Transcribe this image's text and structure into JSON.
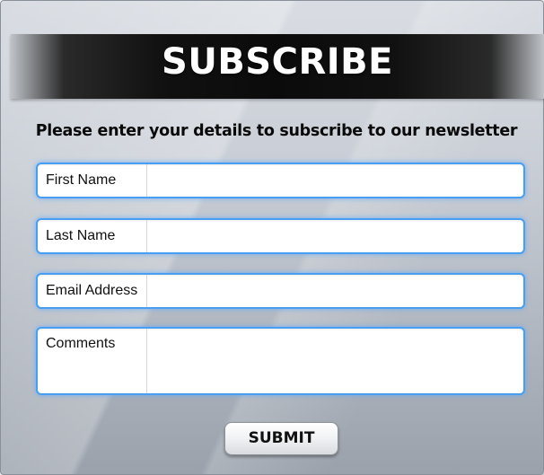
{
  "header": {
    "title": "SUBSCRIBE"
  },
  "intro": {
    "text": "Please enter your details to subscribe to our newsletter"
  },
  "form": {
    "fields": [
      {
        "label": "First Name",
        "value": ""
      },
      {
        "label": "Last Name",
        "value": ""
      },
      {
        "label": "Email Address",
        "value": ""
      },
      {
        "label": "Comments",
        "value": ""
      }
    ],
    "submit_label": "SUBMIT"
  },
  "colors": {
    "header_bg": "#0b0b0b",
    "field_border": "#4a9ef2",
    "text": "#111111"
  }
}
